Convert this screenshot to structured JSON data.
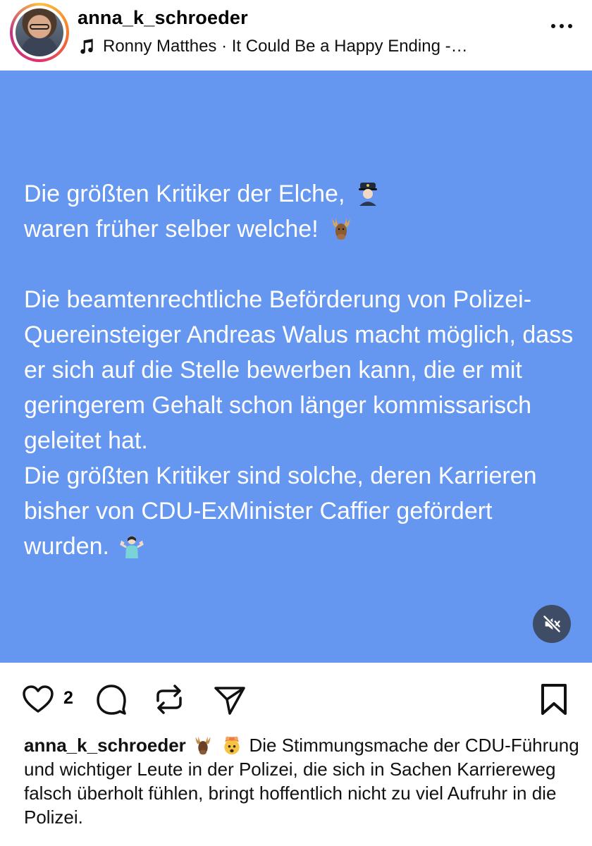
{
  "header": {
    "username": "anna_k_schroeder",
    "music": "Ronny Matthes · It Could Be a Happy Ending -…",
    "music_icon": "music-note-icon",
    "more_icon": "more-options-icon"
  },
  "post": {
    "background_color": "#6597f1",
    "line1": "Die größten Kritiker der Elche,",
    "line1_emoji": "police-officer-emoji",
    "line2": "waren früher selber welche!",
    "line2_emoji": "moose-emoji",
    "paragraph": "Die beamtenrechtliche Beförderung von Polizei-Quereinsteiger Andreas Walus macht möglich, dass er sich auf die Stelle bewerben kann, die er mit geringerem Gehalt schon länger kommissarisch geleitet hat.",
    "paragraph2": "Die größten Kritiker sind solche, deren Karrieren bisher von CDU-ExMinister Caffier gefördert wurden.",
    "paragraph2_emoji": "person-shrugging-emoji",
    "mute_icon": "speaker-muted-icon"
  },
  "actions": {
    "like_icon": "heart-icon",
    "like_count": "2",
    "comment_icon": "comment-icon",
    "repost_icon": "repost-icon",
    "share_icon": "send-icon",
    "save_icon": "bookmark-icon"
  },
  "caption": {
    "username": "anna_k_schroeder",
    "emojis": [
      "moose-emoji",
      "exploding-head-emoji"
    ],
    "text": "Die Stimmungsmache der CDU-Führung und wichtiger Leute in der Polizei, die sich in Sachen Karriereweg falsch überholt fühlen, bringt hoffentlich nicht zu viel Aufruhr in die Polizei."
  }
}
